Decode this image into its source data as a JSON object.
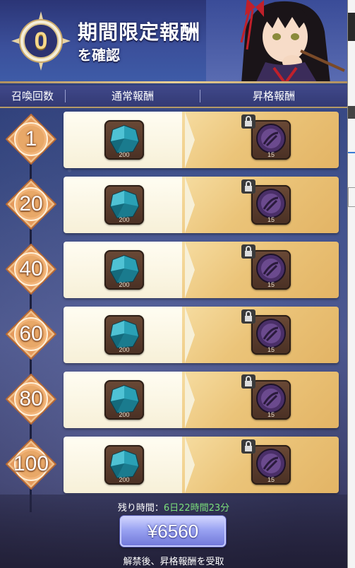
{
  "header": {
    "summon_count": "0",
    "title_line1": "期間限定報酬",
    "title_line2": "を確認"
  },
  "columns": {
    "count": "召喚回数",
    "normal": "通常報酬",
    "premium": "昇格報酬"
  },
  "rows": [
    {
      "milestone": "1",
      "normal_qty": "200",
      "premium_qty": "15"
    },
    {
      "milestone": "20",
      "normal_qty": "200",
      "premium_qty": "15"
    },
    {
      "milestone": "40",
      "normal_qty": "200",
      "premium_qty": "15"
    },
    {
      "milestone": "60",
      "normal_qty": "200",
      "premium_qty": "15"
    },
    {
      "milestone": "80",
      "normal_qty": "200",
      "premium_qty": "15"
    },
    {
      "milestone": "100",
      "normal_qty": "200",
      "premium_qty": "15"
    }
  ],
  "footer": {
    "remaining_label": "残り時間：",
    "remaining_value": "6日22時間23分",
    "price": "¥6560",
    "note": "解禁後、昇格報酬を受取"
  },
  "icons": {
    "normal_reward": "blue-gem-icon",
    "premium_reward": "purple-coin-icon",
    "locked": "lock-icon"
  },
  "colors": {
    "remaining_value": "#7be07b",
    "medal": "#e8a868",
    "buy_button": "#8a91e8"
  }
}
